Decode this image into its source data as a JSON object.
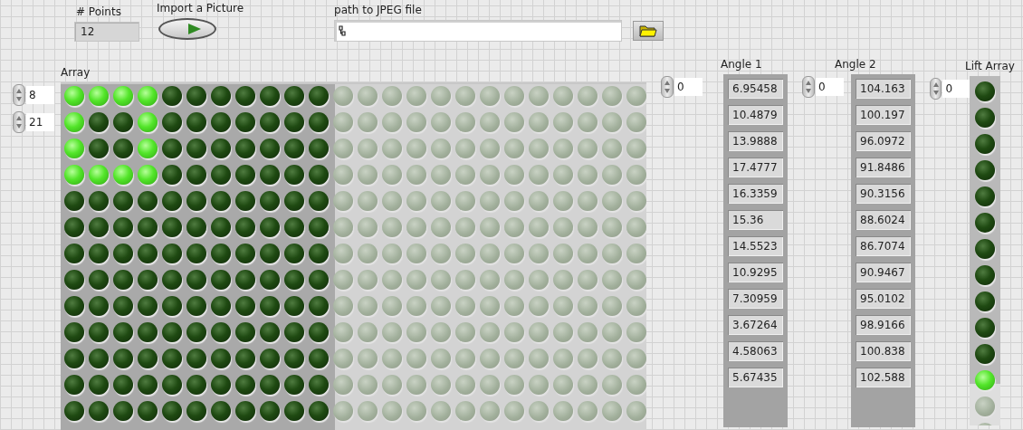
{
  "points": {
    "label": "# Points",
    "value": "12"
  },
  "import_button": {
    "label": "Import a Picture"
  },
  "path": {
    "label": "path to JPEG file"
  },
  "led_array": {
    "label": "Array",
    "indices": [
      "8",
      "21"
    ],
    "rows": [
      [
        true,
        true,
        true,
        true,
        false,
        false,
        false,
        false,
        false,
        false,
        false,
        null,
        null,
        null,
        null,
        null,
        null,
        null,
        null,
        null,
        null,
        null,
        null,
        null
      ],
      [
        true,
        false,
        false,
        true,
        false,
        false,
        false,
        false,
        false,
        false,
        false,
        null,
        null,
        null,
        null,
        null,
        null,
        null,
        null,
        null,
        null,
        null,
        null,
        null
      ],
      [
        true,
        false,
        false,
        true,
        false,
        false,
        false,
        false,
        false,
        false,
        false,
        null,
        null,
        null,
        null,
        null,
        null,
        null,
        null,
        null,
        null,
        null,
        null,
        null
      ],
      [
        true,
        true,
        true,
        true,
        false,
        false,
        false,
        false,
        false,
        false,
        false,
        null,
        null,
        null,
        null,
        null,
        null,
        null,
        null,
        null,
        null,
        null,
        null,
        null
      ],
      [
        false,
        false,
        false,
        false,
        false,
        false,
        false,
        false,
        false,
        false,
        false,
        null,
        null,
        null,
        null,
        null,
        null,
        null,
        null,
        null,
        null,
        null,
        null,
        null
      ],
      [
        false,
        false,
        false,
        false,
        false,
        false,
        false,
        false,
        false,
        false,
        false,
        null,
        null,
        null,
        null,
        null,
        null,
        null,
        null,
        null,
        null,
        null,
        null,
        null
      ],
      [
        false,
        false,
        false,
        false,
        false,
        false,
        false,
        false,
        false,
        false,
        false,
        null,
        null,
        null,
        null,
        null,
        null,
        null,
        null,
        null,
        null,
        null,
        null,
        null
      ],
      [
        false,
        false,
        false,
        false,
        false,
        false,
        false,
        false,
        false,
        false,
        false,
        null,
        null,
        null,
        null,
        null,
        null,
        null,
        null,
        null,
        null,
        null,
        null,
        null
      ],
      [
        false,
        false,
        false,
        false,
        false,
        false,
        false,
        false,
        false,
        false,
        false,
        null,
        null,
        null,
        null,
        null,
        null,
        null,
        null,
        null,
        null,
        null,
        null,
        null
      ],
      [
        false,
        false,
        false,
        false,
        false,
        false,
        false,
        false,
        false,
        false,
        false,
        null,
        null,
        null,
        null,
        null,
        null,
        null,
        null,
        null,
        null,
        null,
        null,
        null
      ],
      [
        false,
        false,
        false,
        false,
        false,
        false,
        false,
        false,
        false,
        false,
        false,
        null,
        null,
        null,
        null,
        null,
        null,
        null,
        null,
        null,
        null,
        null,
        null,
        null
      ],
      [
        false,
        false,
        false,
        false,
        false,
        false,
        false,
        false,
        false,
        false,
        false,
        null,
        null,
        null,
        null,
        null,
        null,
        null,
        null,
        null,
        null,
        null,
        null,
        null
      ],
      [
        false,
        false,
        false,
        false,
        false,
        false,
        false,
        false,
        false,
        false,
        false,
        null,
        null,
        null,
        null,
        null,
        null,
        null,
        null,
        null,
        null,
        null,
        null,
        null
      ]
    ]
  },
  "angle_1": {
    "label": "Angle 1",
    "index": "0",
    "values": [
      "6.95458",
      "10.4879",
      "13.9888",
      "17.4777",
      "16.3359",
      "15.36",
      "14.5523",
      "10.9295",
      "7.30959",
      "3.67264",
      "4.58063",
      "5.67435"
    ]
  },
  "angle_2": {
    "label": "Angle 2",
    "index": "0",
    "values": [
      "104.163",
      "100.197",
      "96.0972",
      "91.8486",
      "90.3156",
      "88.6024",
      "86.7074",
      "90.9467",
      "95.0102",
      "98.9166",
      "100.838",
      "102.588"
    ]
  },
  "lift_array": {
    "label": "Lift Array",
    "index": "0",
    "values": [
      {
        "kind": "led",
        "on": false
      },
      {
        "kind": "led",
        "on": false
      },
      {
        "kind": "led",
        "on": false
      },
      {
        "kind": "led",
        "on": false
      },
      {
        "kind": "led",
        "on": false
      },
      {
        "kind": "led",
        "on": false
      },
      {
        "kind": "led",
        "on": false
      },
      {
        "kind": "led",
        "on": false
      },
      {
        "kind": "led",
        "on": false
      },
      {
        "kind": "led",
        "on": false
      },
      {
        "kind": "led",
        "on": false
      },
      {
        "kind": "led",
        "on": true
      },
      {
        "kind": "empty"
      },
      {
        "kind": "empty"
      }
    ]
  }
}
